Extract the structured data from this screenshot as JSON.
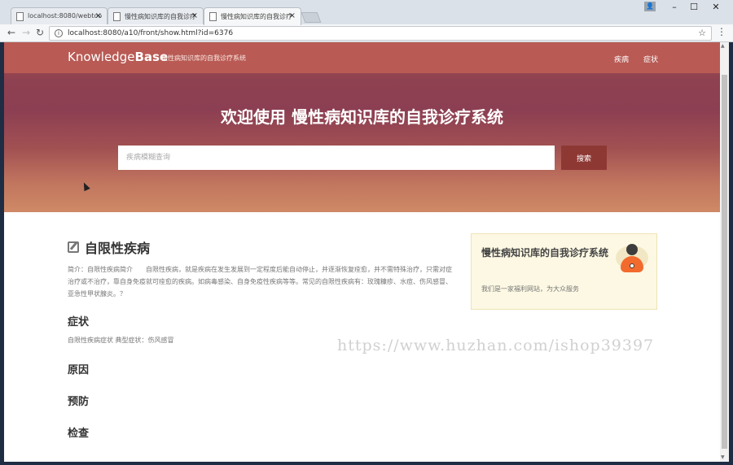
{
  "browser": {
    "tabs": [
      {
        "title": "localhost:8080/webtoo"
      },
      {
        "title": "慢性病知识库的自我诊疗"
      },
      {
        "title": "慢性病知识库的自我诊疗"
      }
    ],
    "url": "localhost:8080/a10/front/show.html?id=6376",
    "window": {
      "minimize": "–",
      "maximize": "☐",
      "close": "✕"
    }
  },
  "site": {
    "brand_light": "Knowledge",
    "brand_bold": "Base",
    "tagline": "慢性病知识库的自我诊疗系统",
    "nav": [
      "疾病",
      "症状"
    ],
    "hero_title": "欢迎使用 慢性病知识库的自我诊疗系统",
    "search": {
      "placeholder": "疾病模糊查询",
      "button": "搜索"
    }
  },
  "disease": {
    "name": "自限性疾病",
    "intro": "简介：自限性疾病简介　　自限性疾病，就是疾病在发生发展到一定程度后能自动停止，并逐渐恢复痊愈，并不需特殊治疗，只需对症治疗或不治疗，靠自身免疫就可痊愈的疾病。如病毒感染、自身免疫性疾病等等。常见的自限性疾病有：玫瑰糠疹、水痘、伤风感冒、亚急性甲状腺炎。？",
    "sections": {
      "symptoms": {
        "title": "症状",
        "text": "自限性疾病症状 典型症状：伤风感冒"
      },
      "cause": {
        "title": "原因"
      },
      "prevention": {
        "title": "预防"
      },
      "exam": {
        "title": "检查"
      }
    }
  },
  "card": {
    "title": "慢性病知识库的自我诊疗系统",
    "subtitle": "我们是一家福利网站，为大众服务"
  },
  "watermark": "https://www.huzhan.com/ishop39397",
  "colors": {
    "header": "#b95a54",
    "search_button": "#8e3834",
    "card_bg": "#fcf8e3"
  }
}
